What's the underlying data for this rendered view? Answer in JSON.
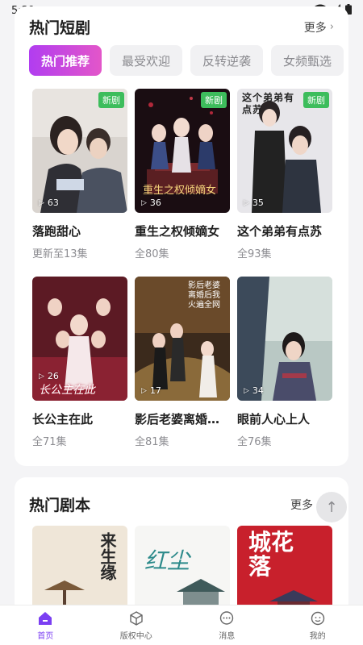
{
  "status_bar": {
    "time": "5:39"
  },
  "hot_dramas": {
    "title": "热门短剧",
    "more_label": "更多",
    "tabs": [
      "热门推荐",
      "最受欢迎",
      "反转逆袭",
      "女频甄选"
    ],
    "items": [
      {
        "title": "落跑甜心",
        "subtitle": "更新至13集",
        "plays": "63",
        "badge": "新剧",
        "poster_text": ""
      },
      {
        "title": "重生之权倾嫡女",
        "subtitle": "全80集",
        "plays": "36",
        "badge": "新剧",
        "poster_text": "重生之权倾嫡女"
      },
      {
        "title": "这个弟弟有点苏",
        "subtitle": "全93集",
        "plays": "35",
        "badge": "新剧",
        "poster_text": "这个弟弟有点苏"
      },
      {
        "title": "长公主在此",
        "subtitle": "全71集",
        "plays": "26",
        "badge": "",
        "poster_text": "长公主在此"
      },
      {
        "title": "影后老婆离婚后我火遍全网",
        "subtitle": "全81集",
        "plays": "17",
        "badge": "",
        "poster_text": "影后老婆离婚后我火遍全网"
      },
      {
        "title": "眼前人心上人",
        "subtitle": "全76集",
        "plays": "34",
        "badge": "",
        "poster_text": ""
      }
    ]
  },
  "hot_scripts": {
    "title": "热门剧本",
    "more_label": "更多",
    "items": [
      {
        "poster_text": "来生缘"
      },
      {
        "poster_text": "红尘"
      },
      {
        "poster_text": "城花落"
      }
    ]
  },
  "bottom_nav": [
    {
      "label": "首页",
      "icon": "home-icon",
      "active": true
    },
    {
      "label": "版权中心",
      "icon": "cube-icon",
      "active": false
    },
    {
      "label": "消息",
      "icon": "message-icon",
      "active": false
    },
    {
      "label": "我的",
      "icon": "profile-icon",
      "active": false
    }
  ],
  "colors": {
    "accent": "#7b3ff2",
    "tab_gradient_start": "#b13df0",
    "tab_gradient_end": "#e356c9",
    "new_badge": "#3dbd5c"
  }
}
